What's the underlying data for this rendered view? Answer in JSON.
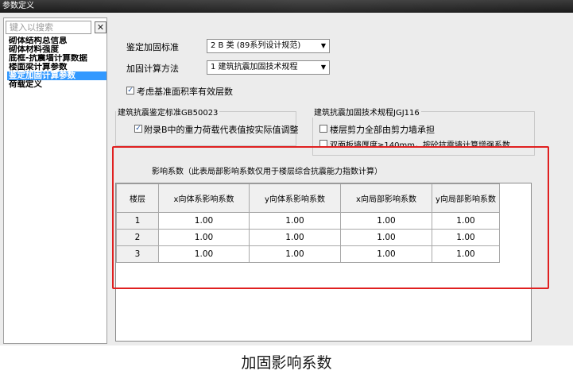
{
  "window": {
    "title": "参数定义"
  },
  "sidebar": {
    "search_placeholder": "键入以搜索",
    "clear_label": "✕",
    "items": [
      {
        "label": "砌体结构总信息",
        "active": false
      },
      {
        "label": "砌体材料强度",
        "active": false
      },
      {
        "label": "底框-抗震墙计算数据",
        "active": false
      },
      {
        "label": "楼面梁计算参数",
        "active": false
      },
      {
        "label": "鉴定加固计算参数",
        "active": true
      },
      {
        "label": "荷载定义",
        "active": false
      }
    ]
  },
  "form": {
    "standard_label": "鉴定加固标准",
    "standard_value": "2 B 类 (89系列设计规范)",
    "method_label": "加固计算方法",
    "method_value": "1 建筑抗震加固技术规程",
    "base_area_checkbox": {
      "label": "考虑基准面积率有效层数",
      "checked": true
    }
  },
  "group_left": {
    "title": "建筑抗震鉴定标准GB50023",
    "checkbox": {
      "label": "附录B中的重力荷载代表值按实际值调整",
      "checked": true
    }
  },
  "group_right": {
    "title": "建筑抗震加固技术规程JGJ116",
    "checkbox1": {
      "label": "楼层剪力全部由剪力墙承担",
      "checked": false
    },
    "checkbox2": {
      "label": "双面板墙厚度≥140mm，按砼抗震墙计算增强系数",
      "checked": false
    }
  },
  "coefficient": {
    "title": "影响系数（此表局部影响系数仅用于楼层综合抗震能力指数计算）",
    "headers": [
      "楼层",
      "x向体系影响系数",
      "y向体系影响系数",
      "x向局部影响系数",
      "y向局部影响系数"
    ],
    "rows": [
      [
        "1",
        "1.00",
        "1.00",
        "1.00",
        "1.00"
      ],
      [
        "2",
        "1.00",
        "1.00",
        "1.00",
        "1.00"
      ],
      [
        "3",
        "1.00",
        "1.00",
        "1.00",
        "1.00"
      ]
    ]
  },
  "caption": "加固影响系数",
  "colors": {
    "active_nav": "#3399ff",
    "highlight_frame": "#e02020"
  }
}
